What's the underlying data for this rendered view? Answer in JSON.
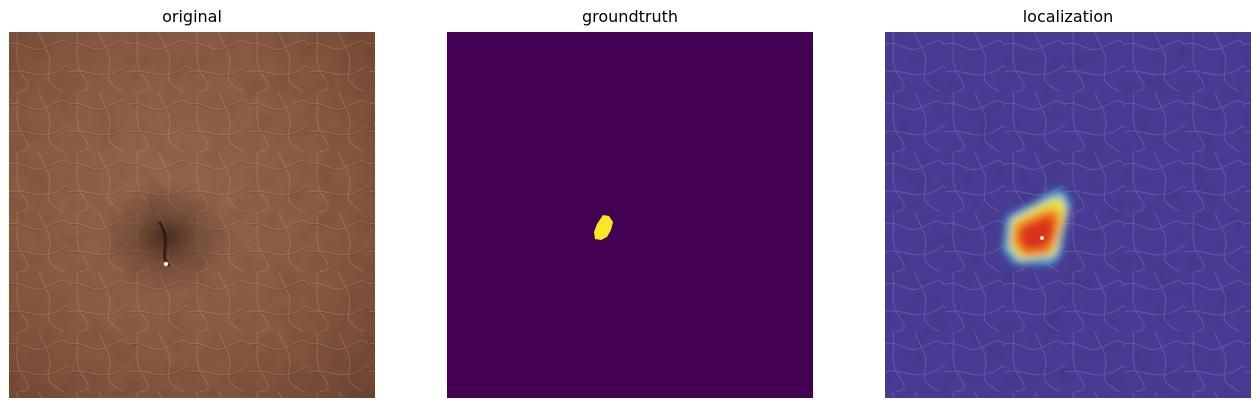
{
  "figure": {
    "panels": [
      {
        "title": "original",
        "kind": "photo"
      },
      {
        "title": "groundtruth",
        "kind": "mask"
      },
      {
        "title": "localization",
        "kind": "heatmap-overlay"
      }
    ]
  },
  "colors": {
    "leather_base": "#8a5a42",
    "leather_dark": "#5e3a28",
    "mask_background": "#440154",
    "mask_foreground": "#fde725",
    "overlay_base": "#4a3c96",
    "heat_hot": "#d9301c",
    "heat_warm": "#f5b21e",
    "heat_cool": "#3fc0e0"
  }
}
